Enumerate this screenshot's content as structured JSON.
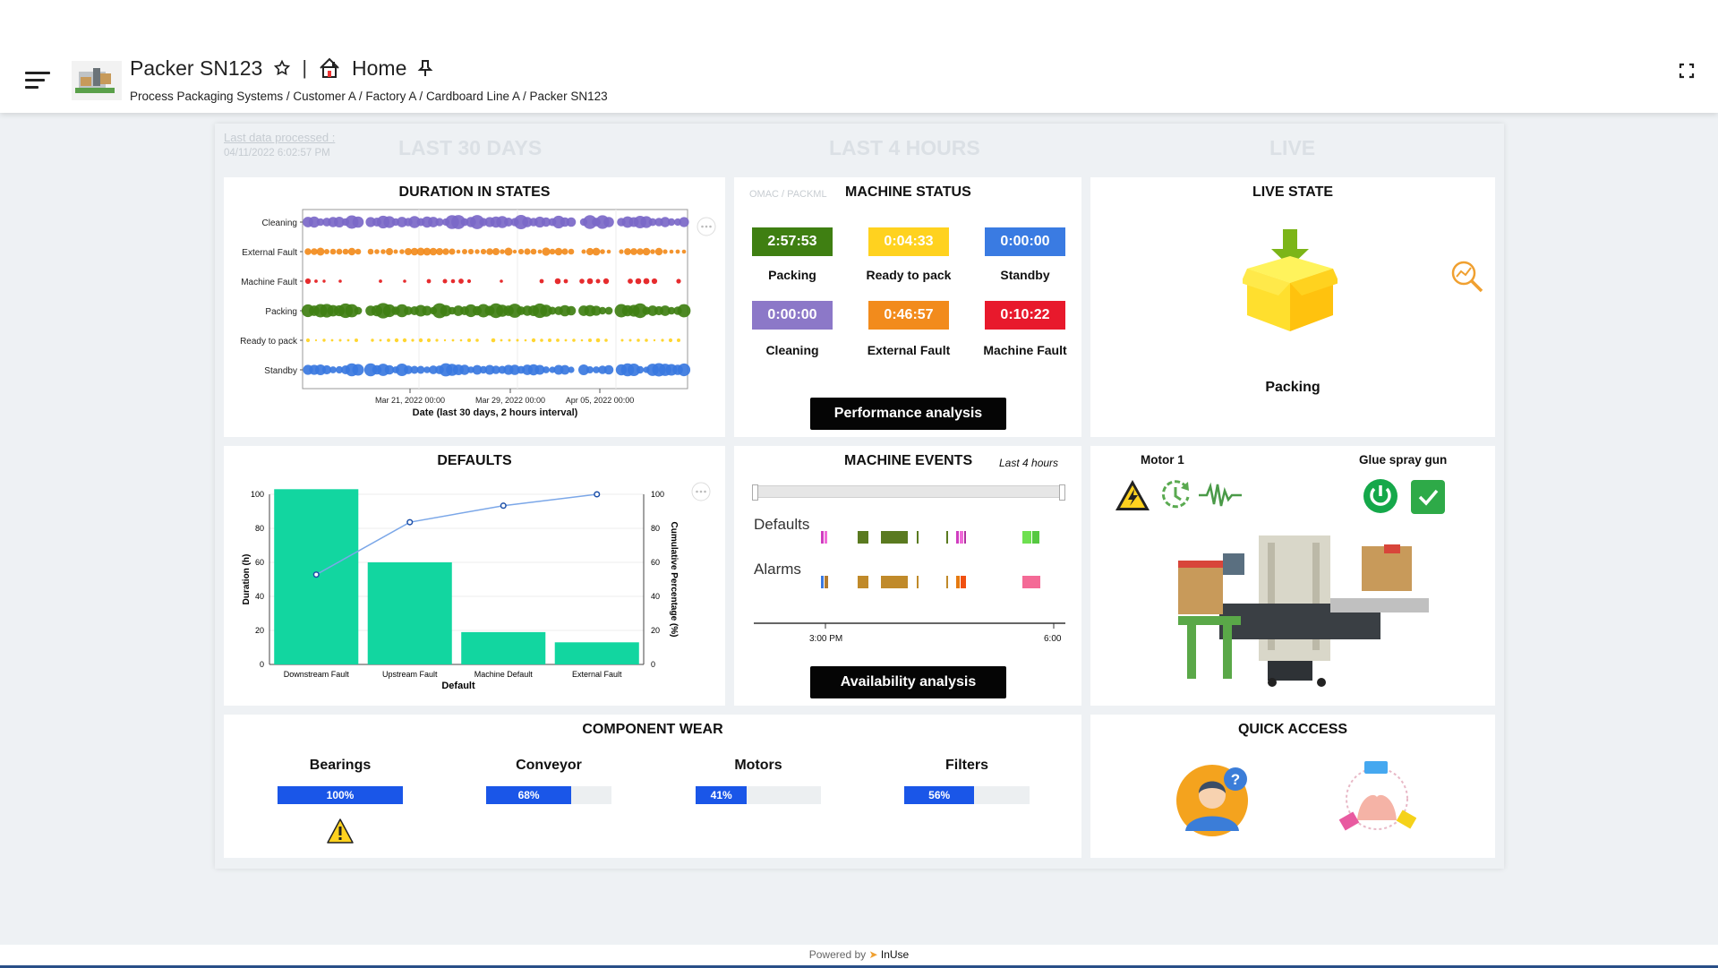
{
  "header": {
    "title": "Packer SN123",
    "home_label": "Home",
    "breadcrumb": [
      "Process Packaging Systems",
      "Customer A",
      "Factory A",
      "Cardboard Line A",
      "Packer SN123"
    ]
  },
  "periods": {
    "last_data_label": "Last data processed :",
    "last_data_date": "04/11/2022 6:02:57 PM",
    "col1": "LAST 30 DAYS",
    "col2": "LAST 4 HOURS",
    "col3": "LIVE"
  },
  "duration_states": {
    "title": "DURATION IN STATES",
    "xlabel": "Date (last 30 days, 2 hours interval)",
    "states": [
      "Cleaning",
      "External Fault",
      "Machine Fault",
      "Packing",
      "Ready to pack",
      "Standby"
    ],
    "xticks": [
      "Mar 21, 2022 00:00",
      "Mar 29, 2022 00:00",
      "Apr 05, 2022 00:00"
    ],
    "colors": [
      "#7b68c8",
      "#f28b1c",
      "#e41a1c",
      "#3f7f12",
      "#ffd21f",
      "#3a78e0"
    ]
  },
  "machine_status": {
    "tag": "OMAC / PACKML",
    "title": "MACHINE STATUS",
    "items": [
      {
        "time": "2:57:53",
        "label": "Packing",
        "color": "#3f7f12"
      },
      {
        "time": "0:04:33",
        "label": "Ready to pack",
        "color": "#ffd21f"
      },
      {
        "time": "0:00:00",
        "label": "Standby",
        "color": "#3a7be2"
      },
      {
        "time": "0:00:00",
        "label": "Cleaning",
        "color": "#8c78c8"
      },
      {
        "time": "0:46:57",
        "label": "External Fault",
        "color": "#f28b1c"
      },
      {
        "time": "0:10:22",
        "label": "Machine Fault",
        "color": "#e8192c"
      }
    ],
    "button": "Performance analysis"
  },
  "live_state": {
    "title": "LIVE STATE",
    "state": "Packing",
    "motor_label": "Motor 1",
    "glue_label": "Glue spray gun"
  },
  "defaults": {
    "title": "DEFAULTS",
    "chart_data": {
      "type": "bar",
      "categories": [
        "Downstream Fault",
        "Upstream Fault",
        "Machine Default",
        "External Fault"
      ],
      "values": [
        103,
        60,
        19,
        13
      ],
      "cumulative": [
        52.8,
        83.6,
        93.3,
        100
      ],
      "xlabel": "Default",
      "ylabel": "Duration (h)",
      "y2label": "Cumulative Percentage (%)",
      "ylim": [
        0,
        100
      ],
      "yticks": [
        0,
        20,
        40,
        60,
        80,
        100
      ]
    }
  },
  "machine_events": {
    "title": "MACHINE EVENTS",
    "subtitle": "Last 4 hours",
    "rows": [
      "Defaults",
      "Alarms"
    ],
    "xticks": [
      "3:00 PM",
      "6:00"
    ],
    "button": "Availability analysis"
  },
  "component_wear": {
    "title": "COMPONENT WEAR",
    "items": [
      {
        "name": "Bearings",
        "percent": 100,
        "label": "100%"
      },
      {
        "name": "Conveyor",
        "percent": 68,
        "label": "68%"
      },
      {
        "name": "Motors",
        "percent": 41,
        "label": "41%"
      },
      {
        "name": "Filters",
        "percent": 56,
        "label": "56%"
      }
    ]
  },
  "quick_access": {
    "title": "QUICK ACCESS"
  },
  "footer": {
    "powered": "Powered by",
    "brand": "InUse"
  }
}
